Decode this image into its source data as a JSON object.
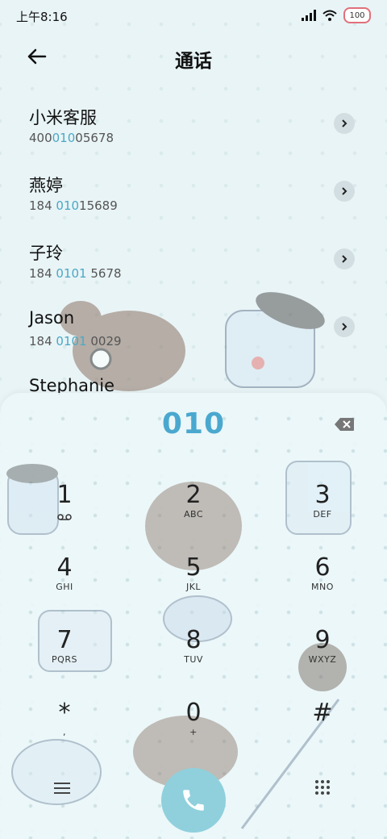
{
  "status_bar": {
    "time": "上午8:16",
    "battery": "100"
  },
  "header": {
    "title": "通话"
  },
  "contacts": [
    {
      "name": "小米客服",
      "num_pre": "400",
      "num_hl": "010",
      "num_post": "05678"
    },
    {
      "name": "燕婷",
      "num_pre": "184 ",
      "num_hl": "010",
      "num_post": "15689"
    },
    {
      "name": "子玲",
      "num_pre": "184 ",
      "num_hl": "0101",
      "num_post": " 5678"
    },
    {
      "name": "Jason",
      "num_pre": "184 ",
      "num_hl": "0101",
      "num_post": " 0029"
    },
    {
      "name": "Stephanie",
      "num_pre": "",
      "num_hl": "",
      "num_post": ""
    }
  ],
  "dialpad": {
    "entered_number": "010",
    "keys": [
      {
        "num": "1",
        "sub": "voicemail"
      },
      {
        "num": "2",
        "sub": "ABC"
      },
      {
        "num": "3",
        "sub": "DEF"
      },
      {
        "num": "4",
        "sub": "GHI"
      },
      {
        "num": "5",
        "sub": "JKL"
      },
      {
        "num": "6",
        "sub": "MNO"
      },
      {
        "num": "7",
        "sub": "PQRS"
      },
      {
        "num": "8",
        "sub": "TUV"
      },
      {
        "num": "9",
        "sub": "WXYZ"
      },
      {
        "num": "*",
        "sub": ","
      },
      {
        "num": "0",
        "sub": "+"
      },
      {
        "num": "#",
        "sub": ""
      }
    ]
  },
  "colors": {
    "accent": "#4aa8cf",
    "call_button": "#8fd0dc"
  },
  "icons": {
    "back": "arrow-left-icon",
    "contact_arrow": "chevron-right-icon",
    "backspace": "backspace-icon",
    "voicemail": "voicemail-icon",
    "menu": "menu-icon",
    "call": "phone-icon",
    "dialpad": "dialpad-grid-icon"
  }
}
